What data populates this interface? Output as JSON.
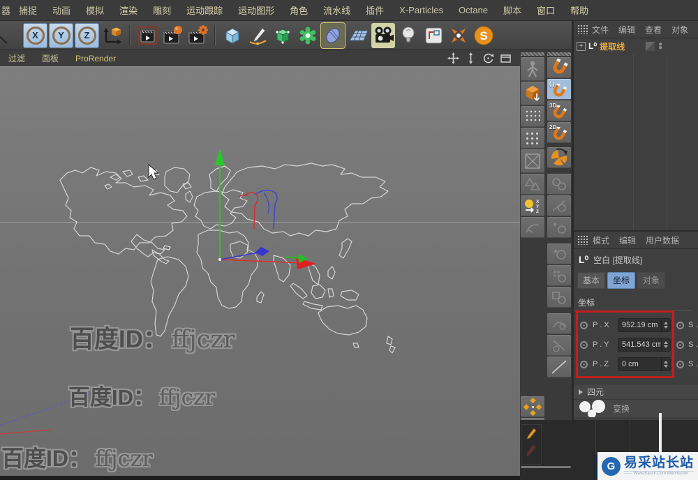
{
  "menubar": {
    "items": [
      "器",
      "捕捉",
      "动画",
      "模拟",
      "渲染",
      "雕刻",
      "运动跟踪",
      "运动图形",
      "角色",
      "流水线",
      "插件",
      "X-Particles",
      "Octane",
      "脚本",
      "窗口",
      "帮助"
    ]
  },
  "toolbar": {
    "axis_lock": [
      "X",
      "Y",
      "Z"
    ],
    "sketch_badge": "S"
  },
  "viewport": {
    "menu": [
      "过滤",
      "面板",
      "ProRender"
    ]
  },
  "snap": {
    "auto_label": "( )",
    "label_3d": "3D",
    "label_2d": "2D"
  },
  "object_manager": {
    "menu": [
      "文件",
      "编辑",
      "查看",
      "对象"
    ],
    "item_icon": "L⁰",
    "item_label": "提取线"
  },
  "attributes": {
    "menu": [
      "模式",
      "编辑",
      "用户数据"
    ],
    "object_icon": "L⁰",
    "object_title": "空白 [提取线]",
    "tabs": [
      "基本",
      "坐标",
      "对象"
    ],
    "active_tab": "坐标",
    "section": "坐标",
    "rows": [
      {
        "label": "P . X",
        "value": "952.19 cm"
      },
      {
        "label": "P . Y",
        "value": "541.543 cm"
      },
      {
        "label": "P . Z",
        "value": "0 cm"
      }
    ],
    "scale_labels": [
      "S .",
      "S .",
      "S ."
    ],
    "quaternion": "四元",
    "transform": "变换"
  },
  "watermark": {
    "prefix": "百度ID：",
    "id": "ffjczr"
  },
  "logo": {
    "badge": "G",
    "title": "易采站长站",
    "tagline": "—— Www.Easck.Com Webmaster"
  },
  "colors": {
    "highlight_red": "#c41d1d",
    "accent_orange": "#e8aa3c",
    "tab_active_blue": "#7fa5d2",
    "axis_x": "#d83030",
    "axis_y": "#28c828",
    "axis_z": "#3838d0"
  }
}
